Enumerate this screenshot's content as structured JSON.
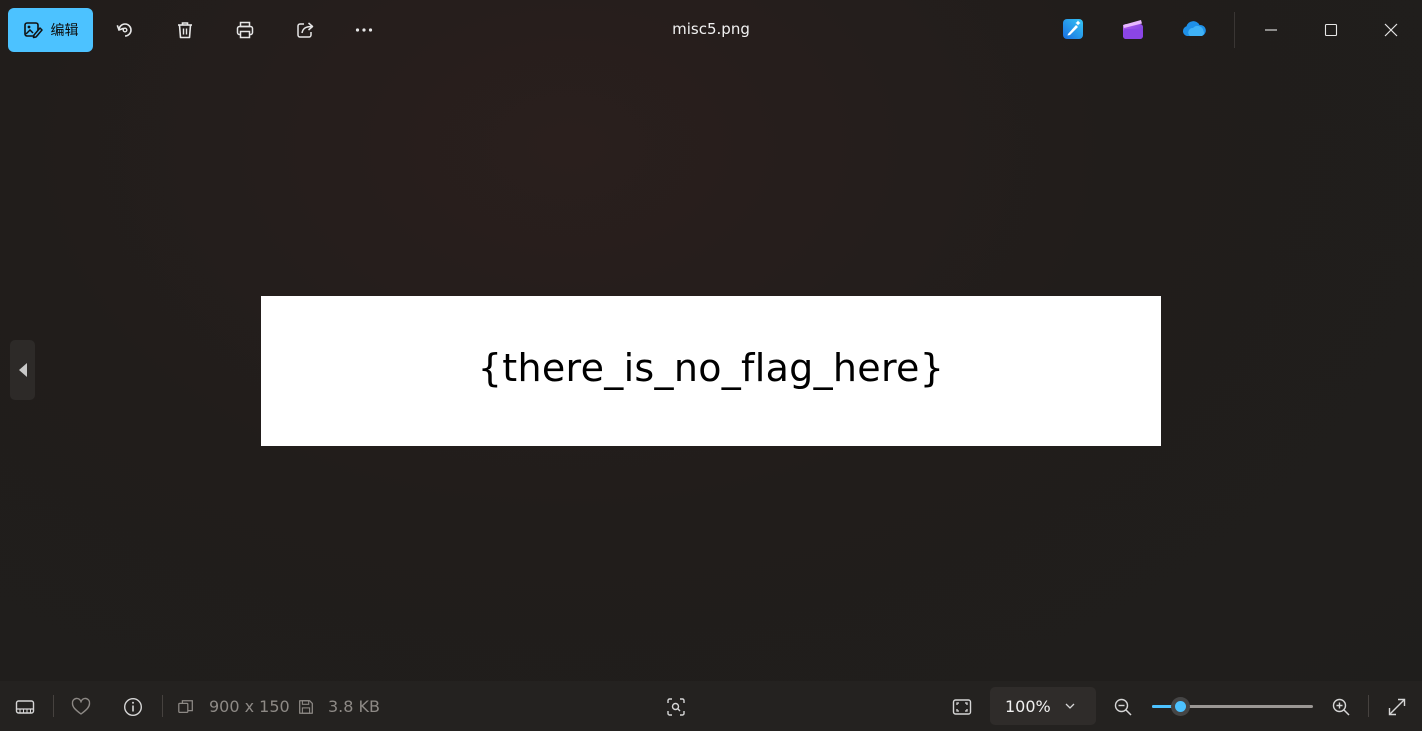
{
  "toolbar": {
    "edit_label": "编辑",
    "edit_icon": "edit-image-icon",
    "tools": [
      "rotate-icon",
      "delete-icon",
      "print-icon",
      "share-icon",
      "more-icon"
    ]
  },
  "window": {
    "title": "misc5.png",
    "app_icons": [
      "designer-app-icon",
      "clipchamp-icon",
      "onedrive-icon"
    ],
    "controls": [
      "minimize-icon",
      "maximize-icon",
      "close-icon"
    ]
  },
  "image": {
    "text": "{there_is_no_flag_here}",
    "background": "#ffffff"
  },
  "navigation": {
    "prev_icon": "previous-arrow-icon"
  },
  "bottombar": {
    "dimensions": "900 x 150",
    "file_size": "3.8 KB",
    "zoom_value": "100%",
    "zoom_level": 0.18
  },
  "colors": {
    "accent": "#4cc2ff",
    "background": "#201c1a",
    "bar": "#242220"
  }
}
